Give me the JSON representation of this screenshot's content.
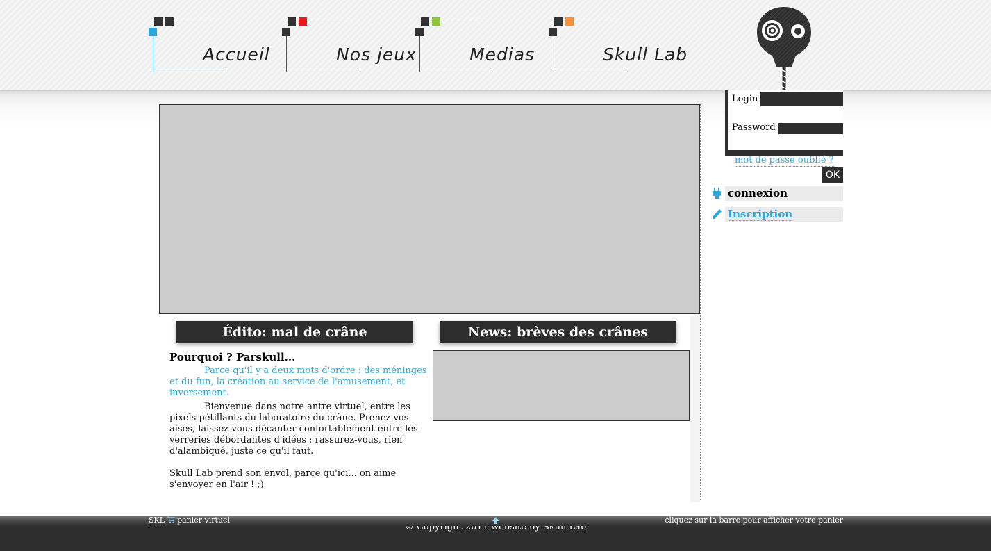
{
  "nav": {
    "items": [
      {
        "label": "Accueil",
        "accent": "#2ba7d9"
      },
      {
        "label": "Nos jeux",
        "accent": "#e31b1b"
      },
      {
        "label": "Medias",
        "accent": "#8cc43c"
      },
      {
        "label": "Skull Lab",
        "accent": "#f5913d"
      }
    ]
  },
  "edito": {
    "title": "Édito: mal de crâne",
    "heading": "Pourquoi ? Parskull...",
    "lead": "Parce qu'il y a deux mots d'ordre : des méninges et du fun, la création au service de l'amusement, et inversement.",
    "body": "Bienvenue dans notre antre virtuel, entre les pixels pétillants du laboratoire du crâne. Prenez vos aises, laissez-vous décanter confortablement entre les verreries débordantes d'idées ; rassurez-vous, rien d'alambiqué, juste ce qu'il faut.",
    "body2": "Skull Lab prend son envol, parce qu'ici... on aime s'envoyer en l'air ! ;)"
  },
  "news": {
    "title": "News: brèves des crânes"
  },
  "login": {
    "login_label": "Login",
    "password_label": "Password",
    "forgot": "mot de passe oublié ?",
    "ok": "OK",
    "connexion": "connexion",
    "inscription": "Inscription"
  },
  "footer": {
    "skl": "SKL",
    "cart": "panier virtuel",
    "cart_hint": "cliquez sur la barre pour afficher votre panier",
    "copyright": "© Copyright 2011 website by Skull Lab"
  },
  "colors": {
    "accent_blue": "#2ba7d9",
    "dark": "#2e2e2e",
    "placeholder_gray": "#cccccc"
  }
}
